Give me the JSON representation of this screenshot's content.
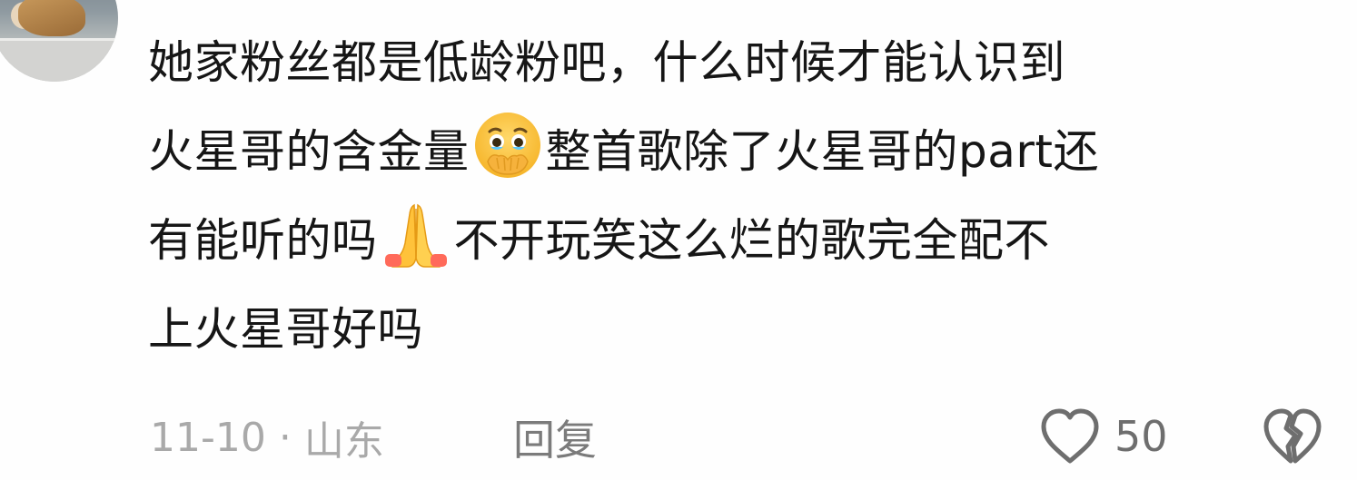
{
  "comment": {
    "lines": [
      {
        "parts": [
          "她家粉丝都是低龄粉吧，什么时候才能认识到"
        ]
      },
      {
        "before": "火星哥的含金量",
        "emoji": "holding-back-tears-emoji",
        "after": "整首歌除了火星哥的part还"
      },
      {
        "before": "有能听的吗",
        "emoji": "folded-hands-emoji",
        "after": "不开玩笑这么烂的歌完全配不"
      },
      {
        "parts": [
          "上火星哥好吗"
        ]
      }
    ],
    "date": "11-10",
    "separator": "·",
    "location": "山东",
    "reply_label": "回复",
    "like_count": "50"
  },
  "colors": {
    "text": "#161616",
    "meta": "#a9a9a9",
    "reply": "#7b7b7b",
    "icon": "#6e6e6e"
  }
}
